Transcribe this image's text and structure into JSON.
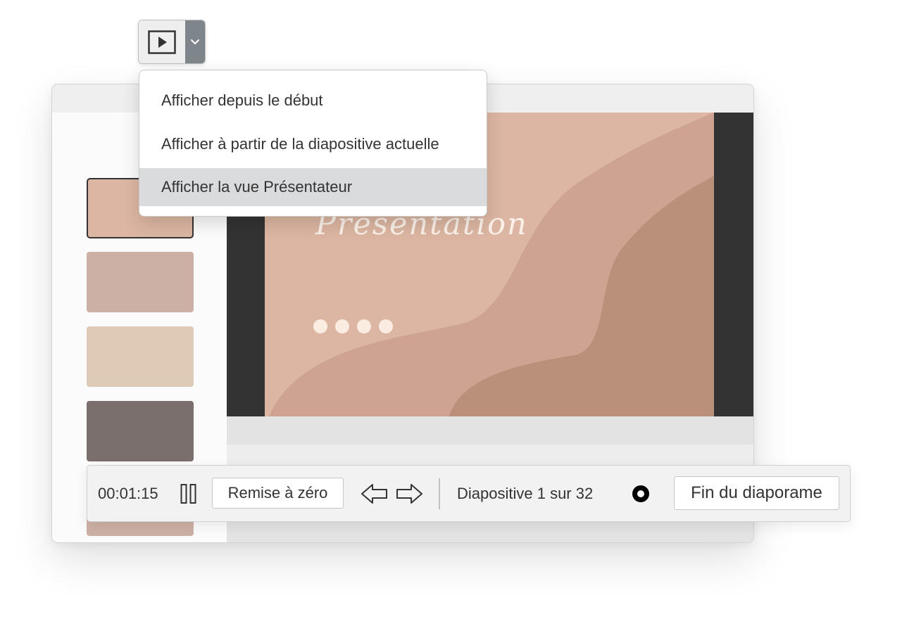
{
  "toolbar": {
    "play_icon": "play-icon",
    "dropdown_icon": "chevron-down-icon",
    "accent_color": "#7f868b"
  },
  "menu": {
    "items": [
      {
        "label": "Afficher depuis le début",
        "active": false
      },
      {
        "label": "Afficher à partir de la diapositive actuelle",
        "active": false
      },
      {
        "label": "Afficher la vue Présentateur",
        "active": true
      }
    ],
    "highlight_color": "#dadbdd"
  },
  "thumbnails": [
    {
      "color": "#dcb6a2",
      "selected": true
    },
    {
      "color": "#cdb0a5",
      "selected": false
    },
    {
      "color": "#dfc9b7",
      "selected": false
    },
    {
      "color": "#7a6f6d",
      "selected": false
    },
    {
      "color": "#cdb0a5",
      "selected": false
    }
  ],
  "slide": {
    "title": "Présentation",
    "dots": 4,
    "colors": {
      "light": "#dcb6a2",
      "mid": "#cea391",
      "dark": "#b99079",
      "frame": "#333333"
    }
  },
  "presenter_bar": {
    "timer": "00:01:15",
    "reset_label": "Remise à zéro",
    "slide_counter": "Diapositive 1 sur 32",
    "end_label": "Fin du diaporame",
    "icons": [
      "pause-icon",
      "prev-arrow-icon",
      "next-arrow-icon",
      "record-icon"
    ]
  }
}
